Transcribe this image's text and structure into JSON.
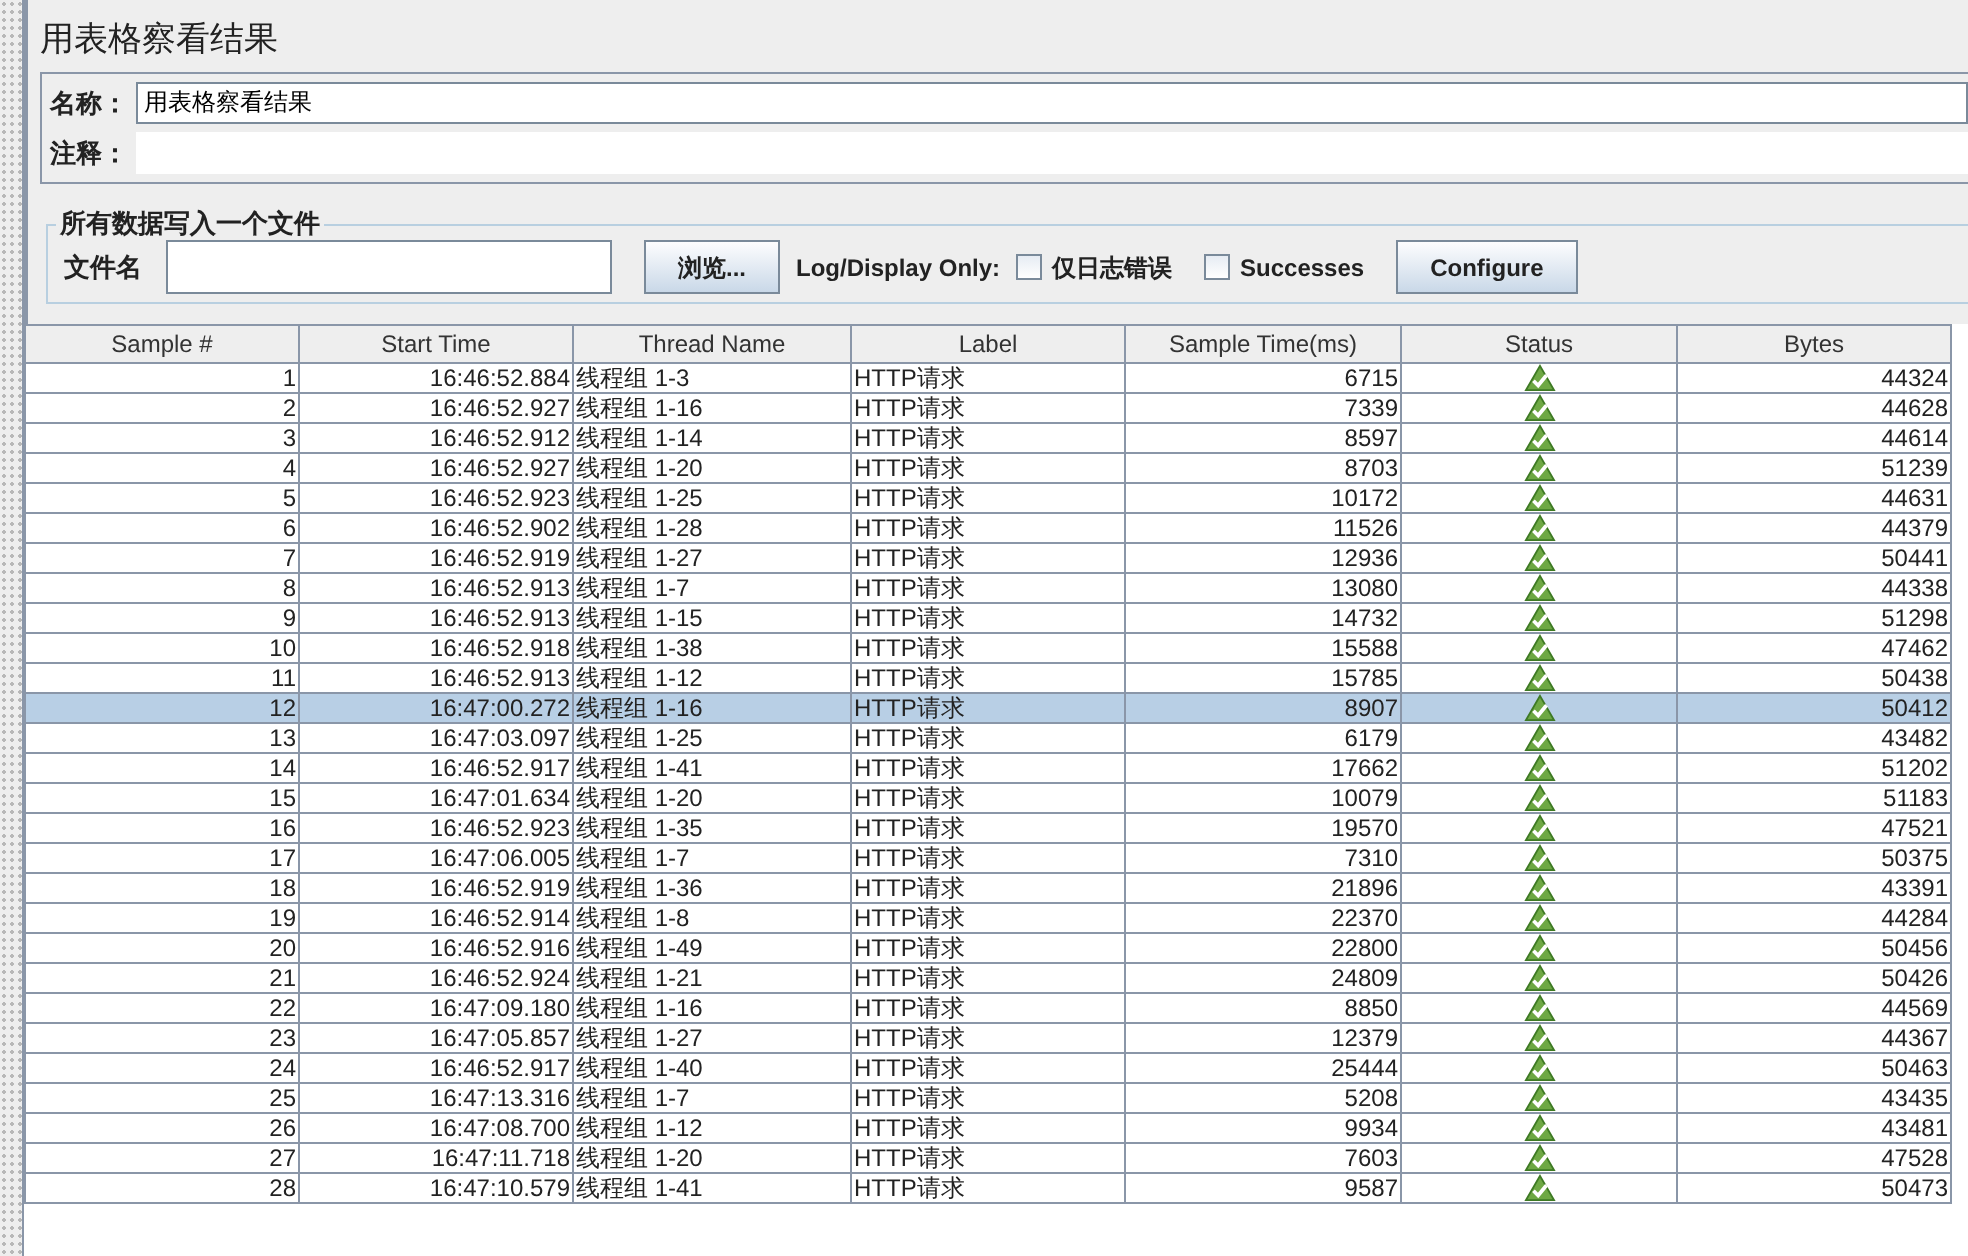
{
  "panel": {
    "title": "用表格察看结果",
    "name_label": "名称：",
    "name_value": "用表格察看结果",
    "comment_label": "注释："
  },
  "file_group": {
    "legend": "所有数据写入一个文件",
    "filename_label": "文件名",
    "browse_button": "浏览...",
    "log_display_label": "Log/Display Only:",
    "options": [
      {
        "label": "仅日志错误",
        "checked": false
      },
      {
        "label": "Successes",
        "checked": false
      }
    ],
    "configure_button": "Configure"
  },
  "table": {
    "columns": [
      "Sample #",
      "Start Time",
      "Thread Name",
      "Label",
      "Sample Time(ms)",
      "Status",
      "Bytes"
    ],
    "rows": [
      {
        "sample": "1",
        "start_time": "16:46:52.884",
        "thread_name": "线程组 1-3",
        "label": "HTTP请求",
        "sample_time": "6715",
        "bytes": "44324",
        "selected": false
      },
      {
        "sample": "2",
        "start_time": "16:46:52.927",
        "thread_name": "线程组 1-16",
        "label": "HTTP请求",
        "sample_time": "7339",
        "bytes": "44628",
        "selected": false
      },
      {
        "sample": "3",
        "start_time": "16:46:52.912",
        "thread_name": "线程组 1-14",
        "label": "HTTP请求",
        "sample_time": "8597",
        "bytes": "44614",
        "selected": false
      },
      {
        "sample": "4",
        "start_time": "16:46:52.927",
        "thread_name": "线程组 1-20",
        "label": "HTTP请求",
        "sample_time": "8703",
        "bytes": "51239",
        "selected": false
      },
      {
        "sample": "5",
        "start_time": "16:46:52.923",
        "thread_name": "线程组 1-25",
        "label": "HTTP请求",
        "sample_time": "10172",
        "bytes": "44631",
        "selected": false
      },
      {
        "sample": "6",
        "start_time": "16:46:52.902",
        "thread_name": "线程组 1-28",
        "label": "HTTP请求",
        "sample_time": "11526",
        "bytes": "44379",
        "selected": false
      },
      {
        "sample": "7",
        "start_time": "16:46:52.919",
        "thread_name": "线程组 1-27",
        "label": "HTTP请求",
        "sample_time": "12936",
        "bytes": "50441",
        "selected": false
      },
      {
        "sample": "8",
        "start_time": "16:46:52.913",
        "thread_name": "线程组 1-7",
        "label": "HTTP请求",
        "sample_time": "13080",
        "bytes": "44338",
        "selected": false
      },
      {
        "sample": "9",
        "start_time": "16:46:52.913",
        "thread_name": "线程组 1-15",
        "label": "HTTP请求",
        "sample_time": "14732",
        "bytes": "51298",
        "selected": false
      },
      {
        "sample": "10",
        "start_time": "16:46:52.918",
        "thread_name": "线程组 1-38",
        "label": "HTTP请求",
        "sample_time": "15588",
        "bytes": "47462",
        "selected": false
      },
      {
        "sample": "11",
        "start_time": "16:46:52.913",
        "thread_name": "线程组 1-12",
        "label": "HTTP请求",
        "sample_time": "15785",
        "bytes": "50438",
        "selected": false
      },
      {
        "sample": "12",
        "start_time": "16:47:00.272",
        "thread_name": "线程组 1-16",
        "label": "HTTP请求",
        "sample_time": "8907",
        "bytes": "50412",
        "selected": true
      },
      {
        "sample": "13",
        "start_time": "16:47:03.097",
        "thread_name": "线程组 1-25",
        "label": "HTTP请求",
        "sample_time": "6179",
        "bytes": "43482",
        "selected": false
      },
      {
        "sample": "14",
        "start_time": "16:46:52.917",
        "thread_name": "线程组 1-41",
        "label": "HTTP请求",
        "sample_time": "17662",
        "bytes": "51202",
        "selected": false
      },
      {
        "sample": "15",
        "start_time": "16:47:01.634",
        "thread_name": "线程组 1-20",
        "label": "HTTP请求",
        "sample_time": "10079",
        "bytes": "51183",
        "selected": false
      },
      {
        "sample": "16",
        "start_time": "16:46:52.923",
        "thread_name": "线程组 1-35",
        "label": "HTTP请求",
        "sample_time": "19570",
        "bytes": "47521",
        "selected": false
      },
      {
        "sample": "17",
        "start_time": "16:47:06.005",
        "thread_name": "线程组 1-7",
        "label": "HTTP请求",
        "sample_time": "7310",
        "bytes": "50375",
        "selected": false
      },
      {
        "sample": "18",
        "start_time": "16:46:52.919",
        "thread_name": "线程组 1-36",
        "label": "HTTP请求",
        "sample_time": "21896",
        "bytes": "43391",
        "selected": false
      },
      {
        "sample": "19",
        "start_time": "16:46:52.914",
        "thread_name": "线程组 1-8",
        "label": "HTTP请求",
        "sample_time": "22370",
        "bytes": "44284",
        "selected": false
      },
      {
        "sample": "20",
        "start_time": "16:46:52.916",
        "thread_name": "线程组 1-49",
        "label": "HTTP请求",
        "sample_time": "22800",
        "bytes": "50456",
        "selected": false
      },
      {
        "sample": "21",
        "start_time": "16:46:52.924",
        "thread_name": "线程组 1-21",
        "label": "HTTP请求",
        "sample_time": "24809",
        "bytes": "50426",
        "selected": false
      },
      {
        "sample": "22",
        "start_time": "16:47:09.180",
        "thread_name": "线程组 1-16",
        "label": "HTTP请求",
        "sample_time": "8850",
        "bytes": "44569",
        "selected": false
      },
      {
        "sample": "23",
        "start_time": "16:47:05.857",
        "thread_name": "线程组 1-27",
        "label": "HTTP请求",
        "sample_time": "12379",
        "bytes": "44367",
        "selected": false
      },
      {
        "sample": "24",
        "start_time": "16:46:52.917",
        "thread_name": "线程组 1-40",
        "label": "HTTP请求",
        "sample_time": "25444",
        "bytes": "50463",
        "selected": false
      },
      {
        "sample": "25",
        "start_time": "16:47:13.316",
        "thread_name": "线程组 1-7",
        "label": "HTTP请求",
        "sample_time": "5208",
        "bytes": "43435",
        "selected": false
      },
      {
        "sample": "26",
        "start_time": "16:47:08.700",
        "thread_name": "线程组 1-12",
        "label": "HTTP请求",
        "sample_time": "9934",
        "bytes": "43481",
        "selected": false
      },
      {
        "sample": "27",
        "start_time": "16:47:11.718",
        "thread_name": "线程组 1-20",
        "label": "HTTP请求",
        "sample_time": "7603",
        "bytes": "47528",
        "selected": false
      },
      {
        "sample": "28",
        "start_time": "16:47:10.579",
        "thread_name": "线程组 1-41",
        "label": "HTTP请求",
        "sample_time": "9587",
        "bytes": "50473",
        "selected": false
      }
    ]
  }
}
